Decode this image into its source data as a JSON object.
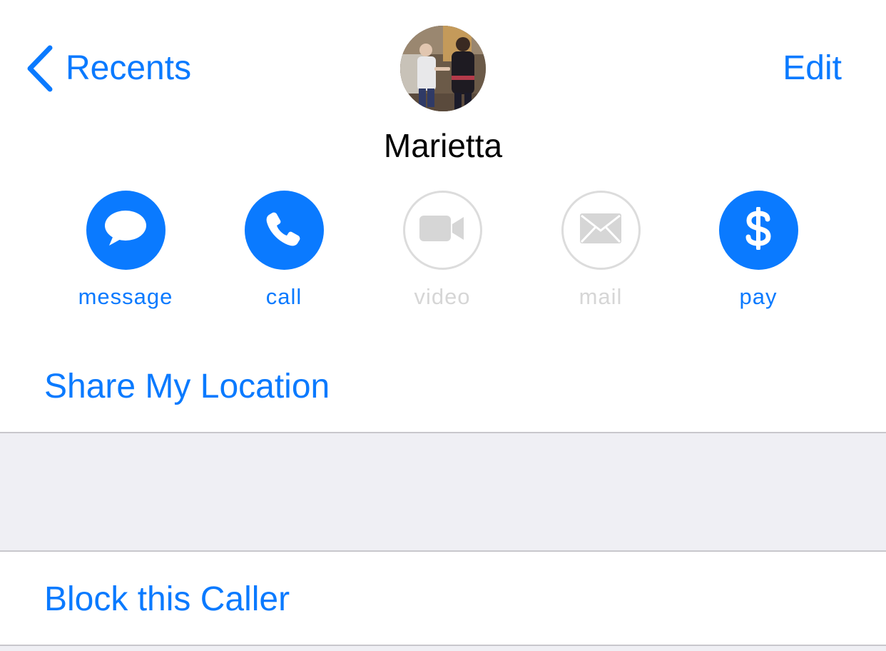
{
  "nav": {
    "back_label": "Recents",
    "edit_label": "Edit"
  },
  "contact": {
    "name": "Marietta"
  },
  "actions": [
    {
      "label": "message",
      "icon": "message-bubble-icon",
      "enabled": true
    },
    {
      "label": "call",
      "icon": "phone-icon",
      "enabled": true
    },
    {
      "label": "video",
      "icon": "video-camera-icon",
      "enabled": false
    },
    {
      "label": "mail",
      "icon": "envelope-icon",
      "enabled": false
    },
    {
      "label": "pay",
      "icon": "dollar-icon",
      "enabled": true
    }
  ],
  "rows": {
    "share_location": "Share My Location",
    "block_caller": "Block this Caller"
  },
  "colors": {
    "accent": "#0a7aff",
    "disabled": "#d6d6d6",
    "group_background": "#efeff4",
    "separator": "#c8c7cc"
  }
}
